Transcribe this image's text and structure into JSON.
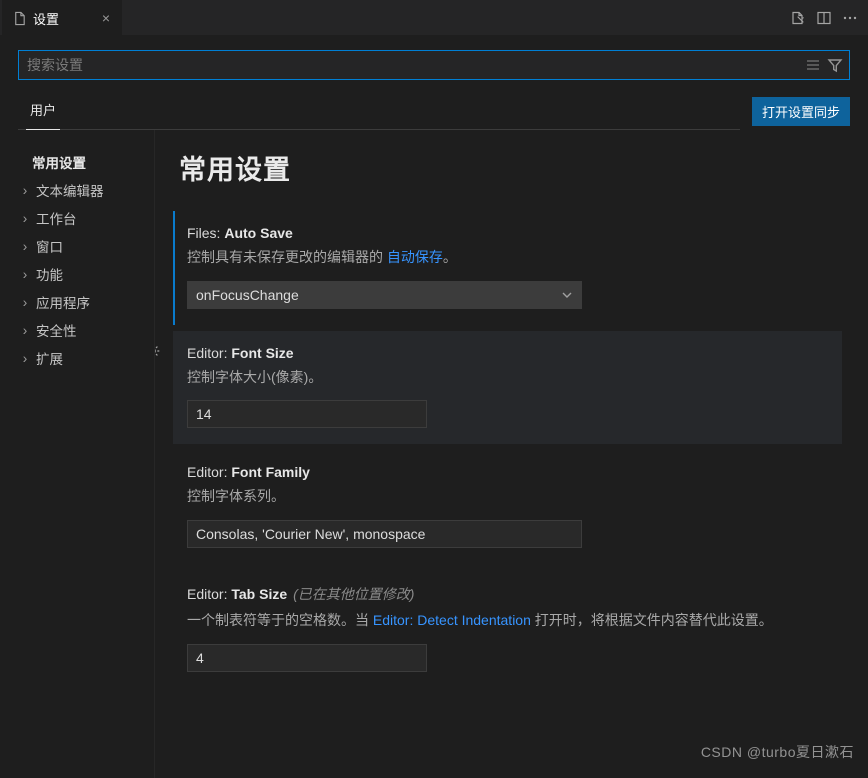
{
  "tab": {
    "label": "设置"
  },
  "search": {
    "placeholder": "搜索设置"
  },
  "scope": {
    "user": "用户"
  },
  "sync_button": "打开设置同步",
  "sidebar": {
    "items": [
      {
        "label": "常用设置",
        "bold": true
      },
      {
        "label": "文本编辑器"
      },
      {
        "label": "工作台"
      },
      {
        "label": "窗口"
      },
      {
        "label": "功能"
      },
      {
        "label": "应用程序"
      },
      {
        "label": "安全性"
      },
      {
        "label": "扩展"
      }
    ]
  },
  "content": {
    "title": "常用设置",
    "autosave": {
      "title_prefix": "Files: ",
      "title_bold": "Auto Save",
      "desc_pre": "控制具有未保存更改的编辑器的 ",
      "desc_link": "自动保存",
      "desc_post": "。",
      "value": "onFocusChange"
    },
    "fontsize": {
      "title_prefix": "Editor: ",
      "title_bold": "Font Size",
      "desc": "控制字体大小(像素)。",
      "value": "14"
    },
    "fontfamily": {
      "title_prefix": "Editor: ",
      "title_bold": "Font Family",
      "desc": "控制字体系列。",
      "value": "Consolas, 'Courier New', monospace"
    },
    "tabsize": {
      "title_prefix": "Editor: ",
      "title_bold": "Tab Size",
      "modified_hint": "(已在其他位置修改)",
      "desc_pre": "一个制表符等于的空格数。当 ",
      "desc_link": "Editor: Detect Indentation",
      "desc_post": " 打开时，将根据文件内容替代此设置。",
      "value": "4"
    }
  },
  "watermark": "CSDN @turbo夏日漱石"
}
